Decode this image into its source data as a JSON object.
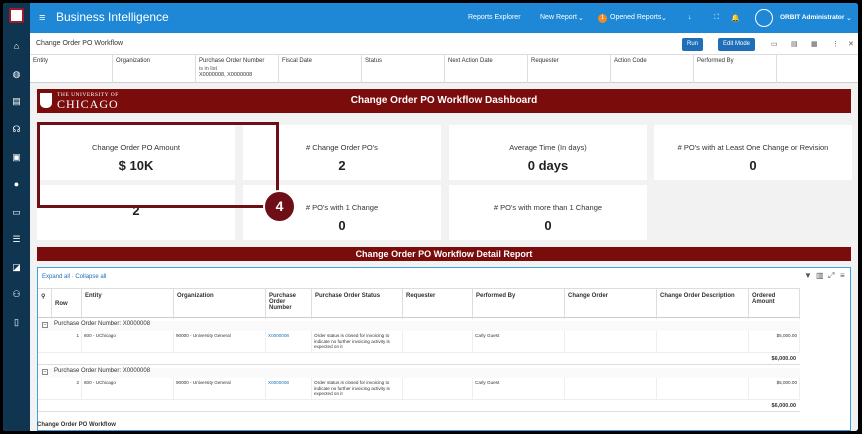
{
  "topbar": {
    "app_title": "Business Intelligence",
    "reports_explorer": "Reports Explorer",
    "new_report": "New Report",
    "opened_reports": "Opened Reports",
    "opened_count": "1",
    "user_name": "ORBIT Administrator"
  },
  "subbar": {
    "page_title": "Change Order PO Workflow",
    "run_label": "Run",
    "edit_mode_label": "Edit Mode"
  },
  "filters": [
    {
      "label": "Entity",
      "value": "",
      "value2": ""
    },
    {
      "label": "Organization",
      "value": "",
      "value2": ""
    },
    {
      "label": "Purchase Order Number",
      "value": "is in list",
      "value2": "X0000008, X0000008"
    },
    {
      "label": "Fiscal Date",
      "value": "",
      "value2": ""
    },
    {
      "label": "Status",
      "value": "",
      "value2": ""
    },
    {
      "label": "Next Action Date",
      "value": "",
      "value2": ""
    },
    {
      "label": "Requester",
      "value": "",
      "value2": ""
    },
    {
      "label": "Action Code",
      "value": "",
      "value2": ""
    },
    {
      "label": "Performed By",
      "value": "",
      "value2": ""
    }
  ],
  "banner": {
    "logo_top": "THE UNIVERSITY OF",
    "logo_main": "CHICAGO",
    "title": "Change Order PO Workflow Dashboard"
  },
  "cards": [
    {
      "title": "Change Order PO Amount",
      "value": "$ 10K"
    },
    {
      "title": "# Change Order PO's",
      "value": "2"
    },
    {
      "title": "Average Time (In days)",
      "value": "0 days"
    },
    {
      "title": "# PO's with at Least One Change or Revision",
      "value": "0"
    },
    {
      "title": "",
      "value": "2"
    },
    {
      "title": "# PO's with 1 Change",
      "value": "0"
    },
    {
      "title": "# PO's with more than 1 Change",
      "value": "0"
    }
  ],
  "callout": "4",
  "report": {
    "title": "Change Order PO Workflow Detail Report",
    "expand_all": "Expand all",
    "collapse_all": "Collapse all",
    "columns": [
      "Row",
      "Entity",
      "Organization",
      "Purchase Order Number",
      "Purchase Order Status",
      "Requester",
      "Performed By",
      "Change Order",
      "Change Order Description",
      "Ordered Amount"
    ],
    "groups": [
      {
        "label": "Purchase Order Number: X0000008",
        "rows": [
          {
            "row": "1",
            "entity": "600 - UChicago",
            "organization": "90000 - University General",
            "po": "X0000008",
            "status": "Order status is closed for invoicing to indicate no further invoicing activity is expected on it",
            "requester": "",
            "performed_by": "Carly Guest",
            "change_order": "",
            "description": "",
            "amount": "$5,000.00"
          }
        ],
        "subtotal": "$6,000.00"
      },
      {
        "label": "Purchase Order Number: X0000008",
        "rows": [
          {
            "row": "2",
            "entity": "600 - UChicago",
            "organization": "90000 - University General",
            "po": "X0000008",
            "status": "Order status is closed for invoicing to indicate no further invoicing activity is expected on it",
            "requester": "",
            "performed_by": "Carly Guest",
            "change_order": "",
            "description": "",
            "amount": "$5,000.00"
          }
        ],
        "subtotal": "$6,000.00"
      }
    ]
  },
  "footer": "Change Order PO Workflow"
}
